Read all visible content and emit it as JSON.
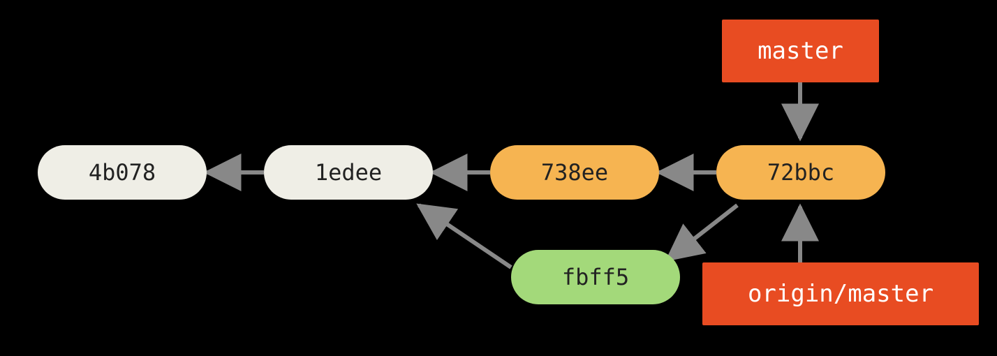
{
  "refs": {
    "master": "master",
    "origin_master": "origin/master"
  },
  "commits": {
    "c0": "4b078",
    "c1": "1edee",
    "c2": "738ee",
    "c3": "72bbc",
    "c4": "fbff5"
  },
  "chart_data": {
    "type": "dag",
    "title": "",
    "nodes": [
      {
        "id": "4b078",
        "kind": "commit",
        "color": "gray"
      },
      {
        "id": "1edee",
        "kind": "commit",
        "color": "gray"
      },
      {
        "id": "738ee",
        "kind": "commit",
        "color": "orange"
      },
      {
        "id": "72bbc",
        "kind": "commit",
        "color": "orange"
      },
      {
        "id": "fbff5",
        "kind": "commit",
        "color": "green"
      },
      {
        "id": "master",
        "kind": "ref"
      },
      {
        "id": "origin/master",
        "kind": "ref"
      }
    ],
    "edges": [
      {
        "from": "1edee",
        "to": "4b078"
      },
      {
        "from": "738ee",
        "to": "1edee"
      },
      {
        "from": "72bbc",
        "to": "738ee"
      },
      {
        "from": "72bbc",
        "to": "fbff5"
      },
      {
        "from": "fbff5",
        "to": "1edee"
      },
      {
        "from": "master",
        "to": "72bbc"
      },
      {
        "from": "origin/master",
        "to": "72bbc"
      }
    ]
  }
}
